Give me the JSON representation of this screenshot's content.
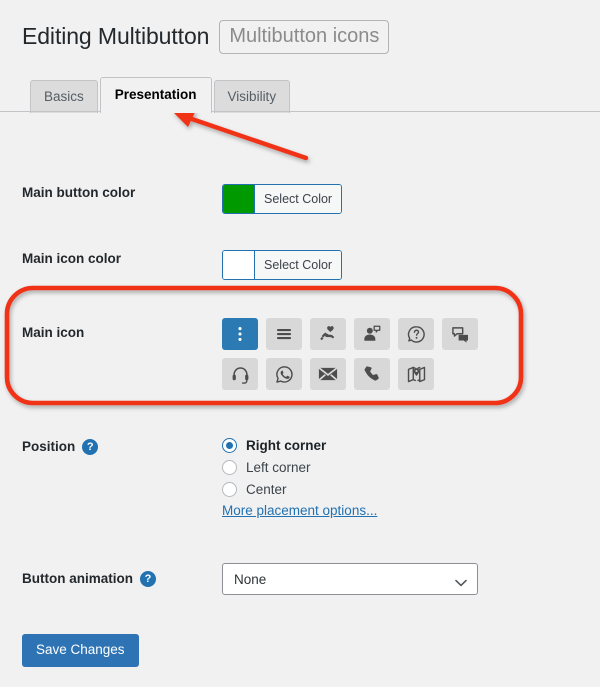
{
  "header": {
    "title": "Editing Multibutton",
    "chip": "Multibutton icons"
  },
  "tabs": [
    {
      "label": "Basics",
      "active": false
    },
    {
      "label": "Presentation",
      "active": true
    },
    {
      "label": "Visibility",
      "active": false
    }
  ],
  "fields": {
    "main_button_color": {
      "label": "Main button color",
      "button_label": "Select Color",
      "swatch_hex": "#009900"
    },
    "main_icon_color": {
      "label": "Main icon color",
      "button_label": "Select Color",
      "swatch_hex": "#ffffff"
    },
    "main_icon": {
      "label": "Main icon",
      "selected_index": 0,
      "icons": [
        {
          "name": "vertical-dots-icon",
          "selected": true
        },
        {
          "name": "hamburger-menu-icon",
          "selected": false
        },
        {
          "name": "hand-heart-icon",
          "selected": false
        },
        {
          "name": "person-speech-bubble-icon",
          "selected": false
        },
        {
          "name": "question-bubble-icon",
          "selected": false
        },
        {
          "name": "chat-bubbles-icon",
          "selected": false
        },
        {
          "name": "headset-icon",
          "selected": false
        },
        {
          "name": "whatsapp-icon",
          "selected": false
        },
        {
          "name": "envelope-icon",
          "selected": false
        },
        {
          "name": "phone-icon",
          "selected": false
        },
        {
          "name": "map-pin-icon",
          "selected": false
        }
      ]
    },
    "position": {
      "label": "Position",
      "help": "?",
      "options": [
        {
          "label": "Right corner",
          "checked": true
        },
        {
          "label": "Left corner",
          "checked": false
        },
        {
          "label": "Center",
          "checked": false
        }
      ],
      "more_link": "More placement options..."
    },
    "button_animation": {
      "label": "Button animation",
      "help": "?",
      "value": "None",
      "options": [
        "None"
      ]
    }
  },
  "actions": {
    "save_label": "Save Changes"
  },
  "annotations": {
    "arrow_color": "#f03018",
    "highlight_color": "#f03018"
  }
}
